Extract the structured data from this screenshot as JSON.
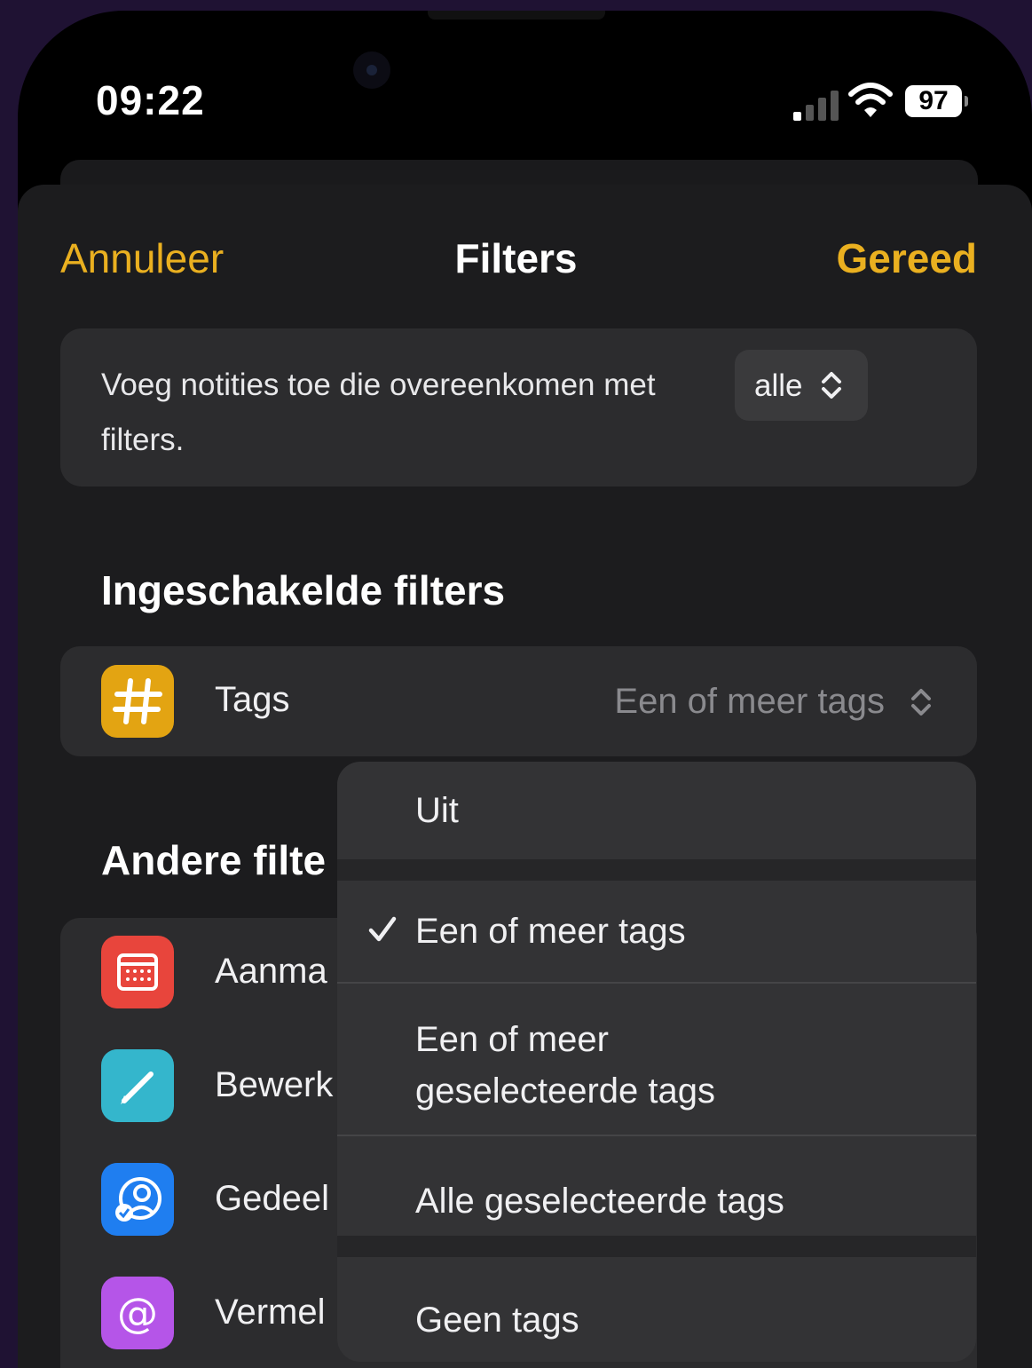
{
  "status_bar": {
    "time": "09:22",
    "battery": "97"
  },
  "nav": {
    "cancel": "Annuleer",
    "title": "Filters",
    "done": "Gereed"
  },
  "match": {
    "text_before": "Voeg notities toe die overeenkomen met",
    "selector": "alle",
    "text_after": "filters."
  },
  "enabled_section": {
    "title": "Ingeschakelde filters",
    "rows": [
      {
        "label": "Tags",
        "value": "Een of meer tags",
        "icon": "hashtag-icon",
        "color": "#e3a412"
      }
    ]
  },
  "other_section": {
    "title": "Andere filte",
    "rows": [
      {
        "label": "Aanma",
        "icon": "calendar-icon",
        "color": "#e8453c"
      },
      {
        "label": "Bewerk",
        "icon": "pencil-icon",
        "color": "#34b6cc"
      },
      {
        "label": "Gedeel",
        "icon": "shared-user-icon",
        "color": "#1f7ef0"
      },
      {
        "label": "Vermel",
        "icon": "at-sign-icon",
        "color": "#b555e8"
      }
    ]
  },
  "menu": {
    "items": [
      {
        "label": "Uit",
        "checked": false
      },
      {
        "label": "Een of meer tags",
        "checked": true
      },
      {
        "label_line1": "Een of meer",
        "label_line2": "geselecteerde tags",
        "checked": false
      },
      {
        "label": "Alle geselecteerde tags",
        "checked": false
      },
      {
        "label": "Geen tags",
        "checked": false
      }
    ]
  },
  "colors": {
    "accent": "#eab020",
    "background": "#1c1c1e",
    "card": "#2c2c2e",
    "menu": "#333335"
  }
}
